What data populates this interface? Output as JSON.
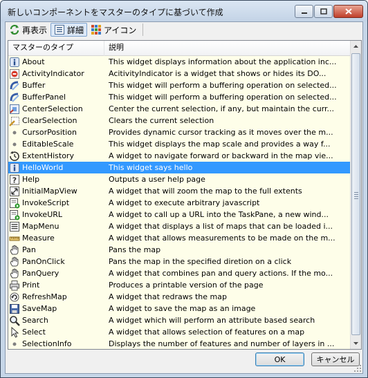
{
  "window": {
    "title": "新しいコンポーネントをマスターのタイプに基づいて作成"
  },
  "toolbar": {
    "refresh_label": "再表示",
    "details_label": "詳細",
    "icons_label": "アイコン"
  },
  "list": {
    "columns": [
      "マスターのタイプ",
      "説明"
    ],
    "rows": [
      {
        "name": "About",
        "desc": "This widget displays information about the application inc...",
        "icon": "info-icon"
      },
      {
        "name": "ActivityIndicator",
        "desc": "AcitivityIndicator is a widget that shows or hides its DO...",
        "icon": "activity-icon"
      },
      {
        "name": "Buffer",
        "desc": "This widget will perform a buffering operation on selected...",
        "icon": "buffer-icon"
      },
      {
        "name": "BufferPanel",
        "desc": "This widget will perform a buffering operation on selected...",
        "icon": "buffer-icon"
      },
      {
        "name": "CenterSelection",
        "desc": "Center the current selection, if any, but maintain the curr...",
        "icon": "center-selection-icon"
      },
      {
        "name": "ClearSelection",
        "desc": "Clears the current selection",
        "icon": "clear-selection-icon"
      },
      {
        "name": "CursorPosition",
        "desc": "Provides dynamic cursor tracking as it moves over the m...",
        "icon": "dot-icon"
      },
      {
        "name": "EditableScale",
        "desc": "This widget displays the map scale and provides a way f...",
        "icon": "dot-icon"
      },
      {
        "name": "ExtentHistory",
        "desc": "A widget to navigate forward or backward in the map vie...",
        "icon": "extent-history-icon"
      },
      {
        "name": "HelloWorld",
        "desc": "This widget says hello",
        "icon": "info-icon"
      },
      {
        "name": "Help",
        "desc": "Outputs a user help page",
        "icon": "help-icon"
      },
      {
        "name": "InitialMapView",
        "desc": "A widget that will zoom the map to the full extents",
        "icon": "zoom-extents-icon"
      },
      {
        "name": "InvokeScript",
        "desc": "A widget to execute arbitrary javascript",
        "icon": "invoke-script-icon"
      },
      {
        "name": "InvokeURL",
        "desc": "A widget to call up a URL into the TaskPane, a new wind...",
        "icon": "invoke-url-icon"
      },
      {
        "name": "MapMenu",
        "desc": "A widget that displays a list of maps that can be loaded i...",
        "icon": "map-menu-icon"
      },
      {
        "name": "Measure",
        "desc": "A widget that allows measurements to be made on the m...",
        "icon": "measure-icon"
      },
      {
        "name": "Pan",
        "desc": "Pans the map",
        "icon": "pan-icon"
      },
      {
        "name": "PanOnClick",
        "desc": "Pans the map in the specified diretion on a click",
        "icon": "pan-icon"
      },
      {
        "name": "PanQuery",
        "desc": "A widget that combines pan and query actions.  If the mo...",
        "icon": "pan-icon"
      },
      {
        "name": "Print",
        "desc": "Produces a printable version of the page",
        "icon": "print-icon"
      },
      {
        "name": "RefreshMap",
        "desc": "A widget that redraws the map",
        "icon": "refresh-icon"
      },
      {
        "name": "SaveMap",
        "desc": "A widget to save the map as an image",
        "icon": "save-icon"
      },
      {
        "name": "Search",
        "desc": "A widget which will perform an attribute based search",
        "icon": "search-icon"
      },
      {
        "name": "Select",
        "desc": "A widget that allows selection of features on a map",
        "icon": "select-cursor-icon"
      },
      {
        "name": "SelectionInfo",
        "desc": "Displays the number of features and number of layers in ...",
        "icon": "dot-icon"
      }
    ],
    "selected_row": "HelloWorld"
  },
  "buttons": {
    "ok": "OK",
    "cancel": "キャンセル"
  },
  "colors": {
    "row_background": "#fefee9",
    "selection": "#3399ff"
  }
}
